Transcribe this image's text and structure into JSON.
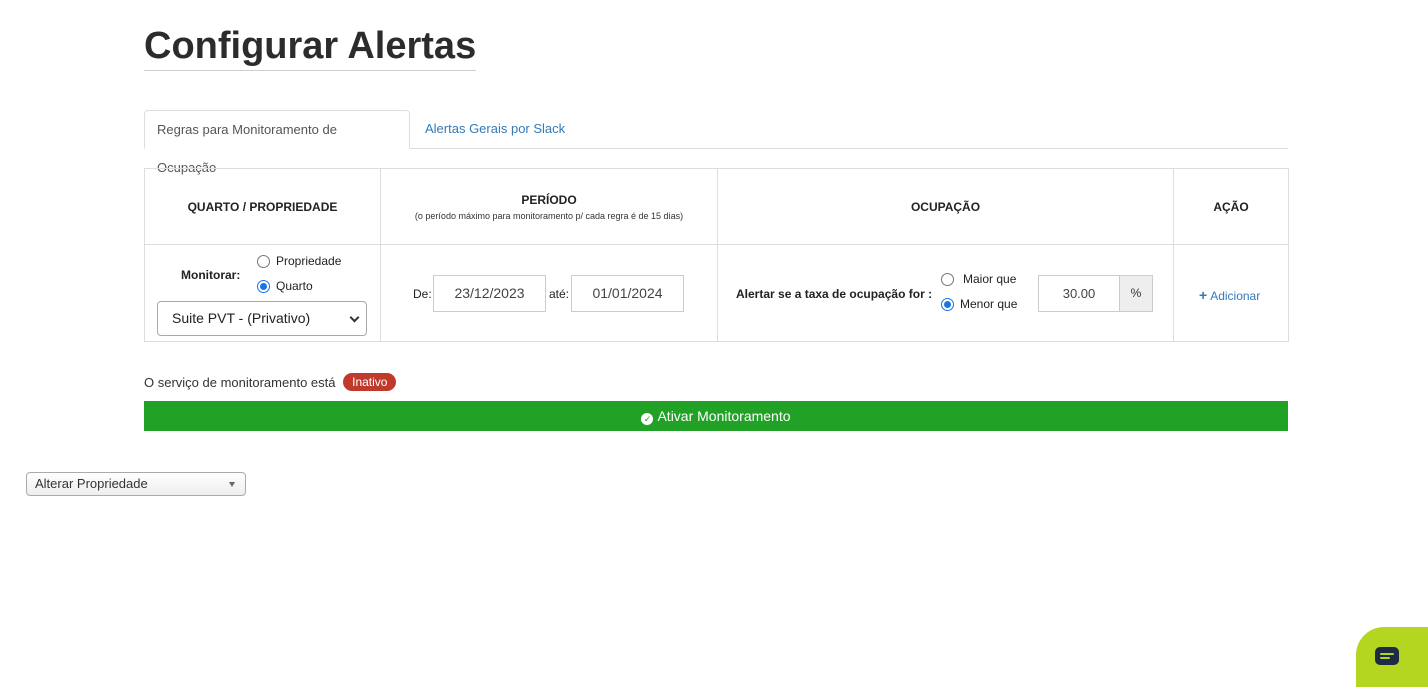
{
  "page": {
    "title": "Configurar Alertas"
  },
  "tabs": [
    {
      "label": "Regras para Monitoramento de Ocupação",
      "active": true
    },
    {
      "label": "Alertas Gerais por Slack",
      "active": false
    }
  ],
  "table": {
    "headers": {
      "room": "QUARTO / PROPRIEDADE",
      "period": "PERÍODO",
      "period_note": "(o período máximo para monitoramento p/ cada regra é de 15 dias)",
      "occupancy": "OCUPAÇÃO",
      "action": "AÇÃO"
    },
    "room": {
      "monitor_label": "Monitorar:",
      "options": [
        {
          "label": "Propriedade",
          "selected": false
        },
        {
          "label": "Quarto",
          "selected": true
        }
      ],
      "selected_room": "Suite PVT - (Privativo)"
    },
    "period": {
      "from_label": "De:",
      "from_value": "23/12/2023",
      "to_label": "até:",
      "to_value": "01/01/2024"
    },
    "occupancy": {
      "alert_label": "Alertar se a taxa de ocupação for :",
      "options": [
        {
          "label": "Maior que",
          "selected": false
        },
        {
          "label": "Menor que",
          "selected": true
        }
      ],
      "value": "30.00",
      "unit": "%"
    },
    "action": {
      "add_label": "Adicionar"
    }
  },
  "status": {
    "text": "O serviço de monitoramento está",
    "badge": "Inativo",
    "badge_color": "#c0392b"
  },
  "activate_button": {
    "label": "Ativar Monitoramento",
    "color": "#21a126"
  },
  "property_select": {
    "value": "Alterar Propriedade"
  },
  "chat_widget": {
    "icon": "chat-icon",
    "color": "#b5d620"
  }
}
